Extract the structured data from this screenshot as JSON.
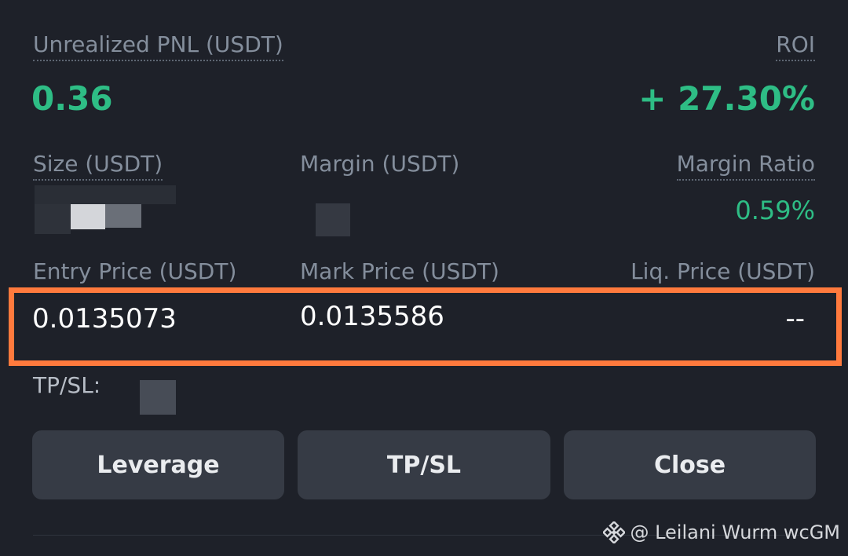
{
  "pnl": {
    "label": "Unrealized PNL (USDT)",
    "value": "0.36"
  },
  "roi": {
    "label": "ROI",
    "value": "+ 27.30%"
  },
  "size": {
    "label": "Size (USDT)"
  },
  "margin": {
    "label": "Margin (USDT)"
  },
  "margin_ratio": {
    "label": "Margin Ratio",
    "value": "0.59%"
  },
  "entry_price": {
    "label": "Entry Price (USDT)",
    "value": "0.0135073"
  },
  "mark_price": {
    "label": "Mark Price (USDT)",
    "value": "0.0135586"
  },
  "liq_price": {
    "label": "Liq. Price (USDT)",
    "value": "--"
  },
  "tpsl": {
    "label": "TP/SL:"
  },
  "buttons": {
    "leverage": "Leverage",
    "tpsl": "TP/SL",
    "close": "Close"
  },
  "watermark": {
    "text": "@ Leilani Wurm wcGM",
    "icon": "binance-logo-icon"
  },
  "colors": {
    "background": "#1e2129",
    "positive": "#2ebd85",
    "highlight": "#ff7a3d",
    "button": "#363b45"
  }
}
